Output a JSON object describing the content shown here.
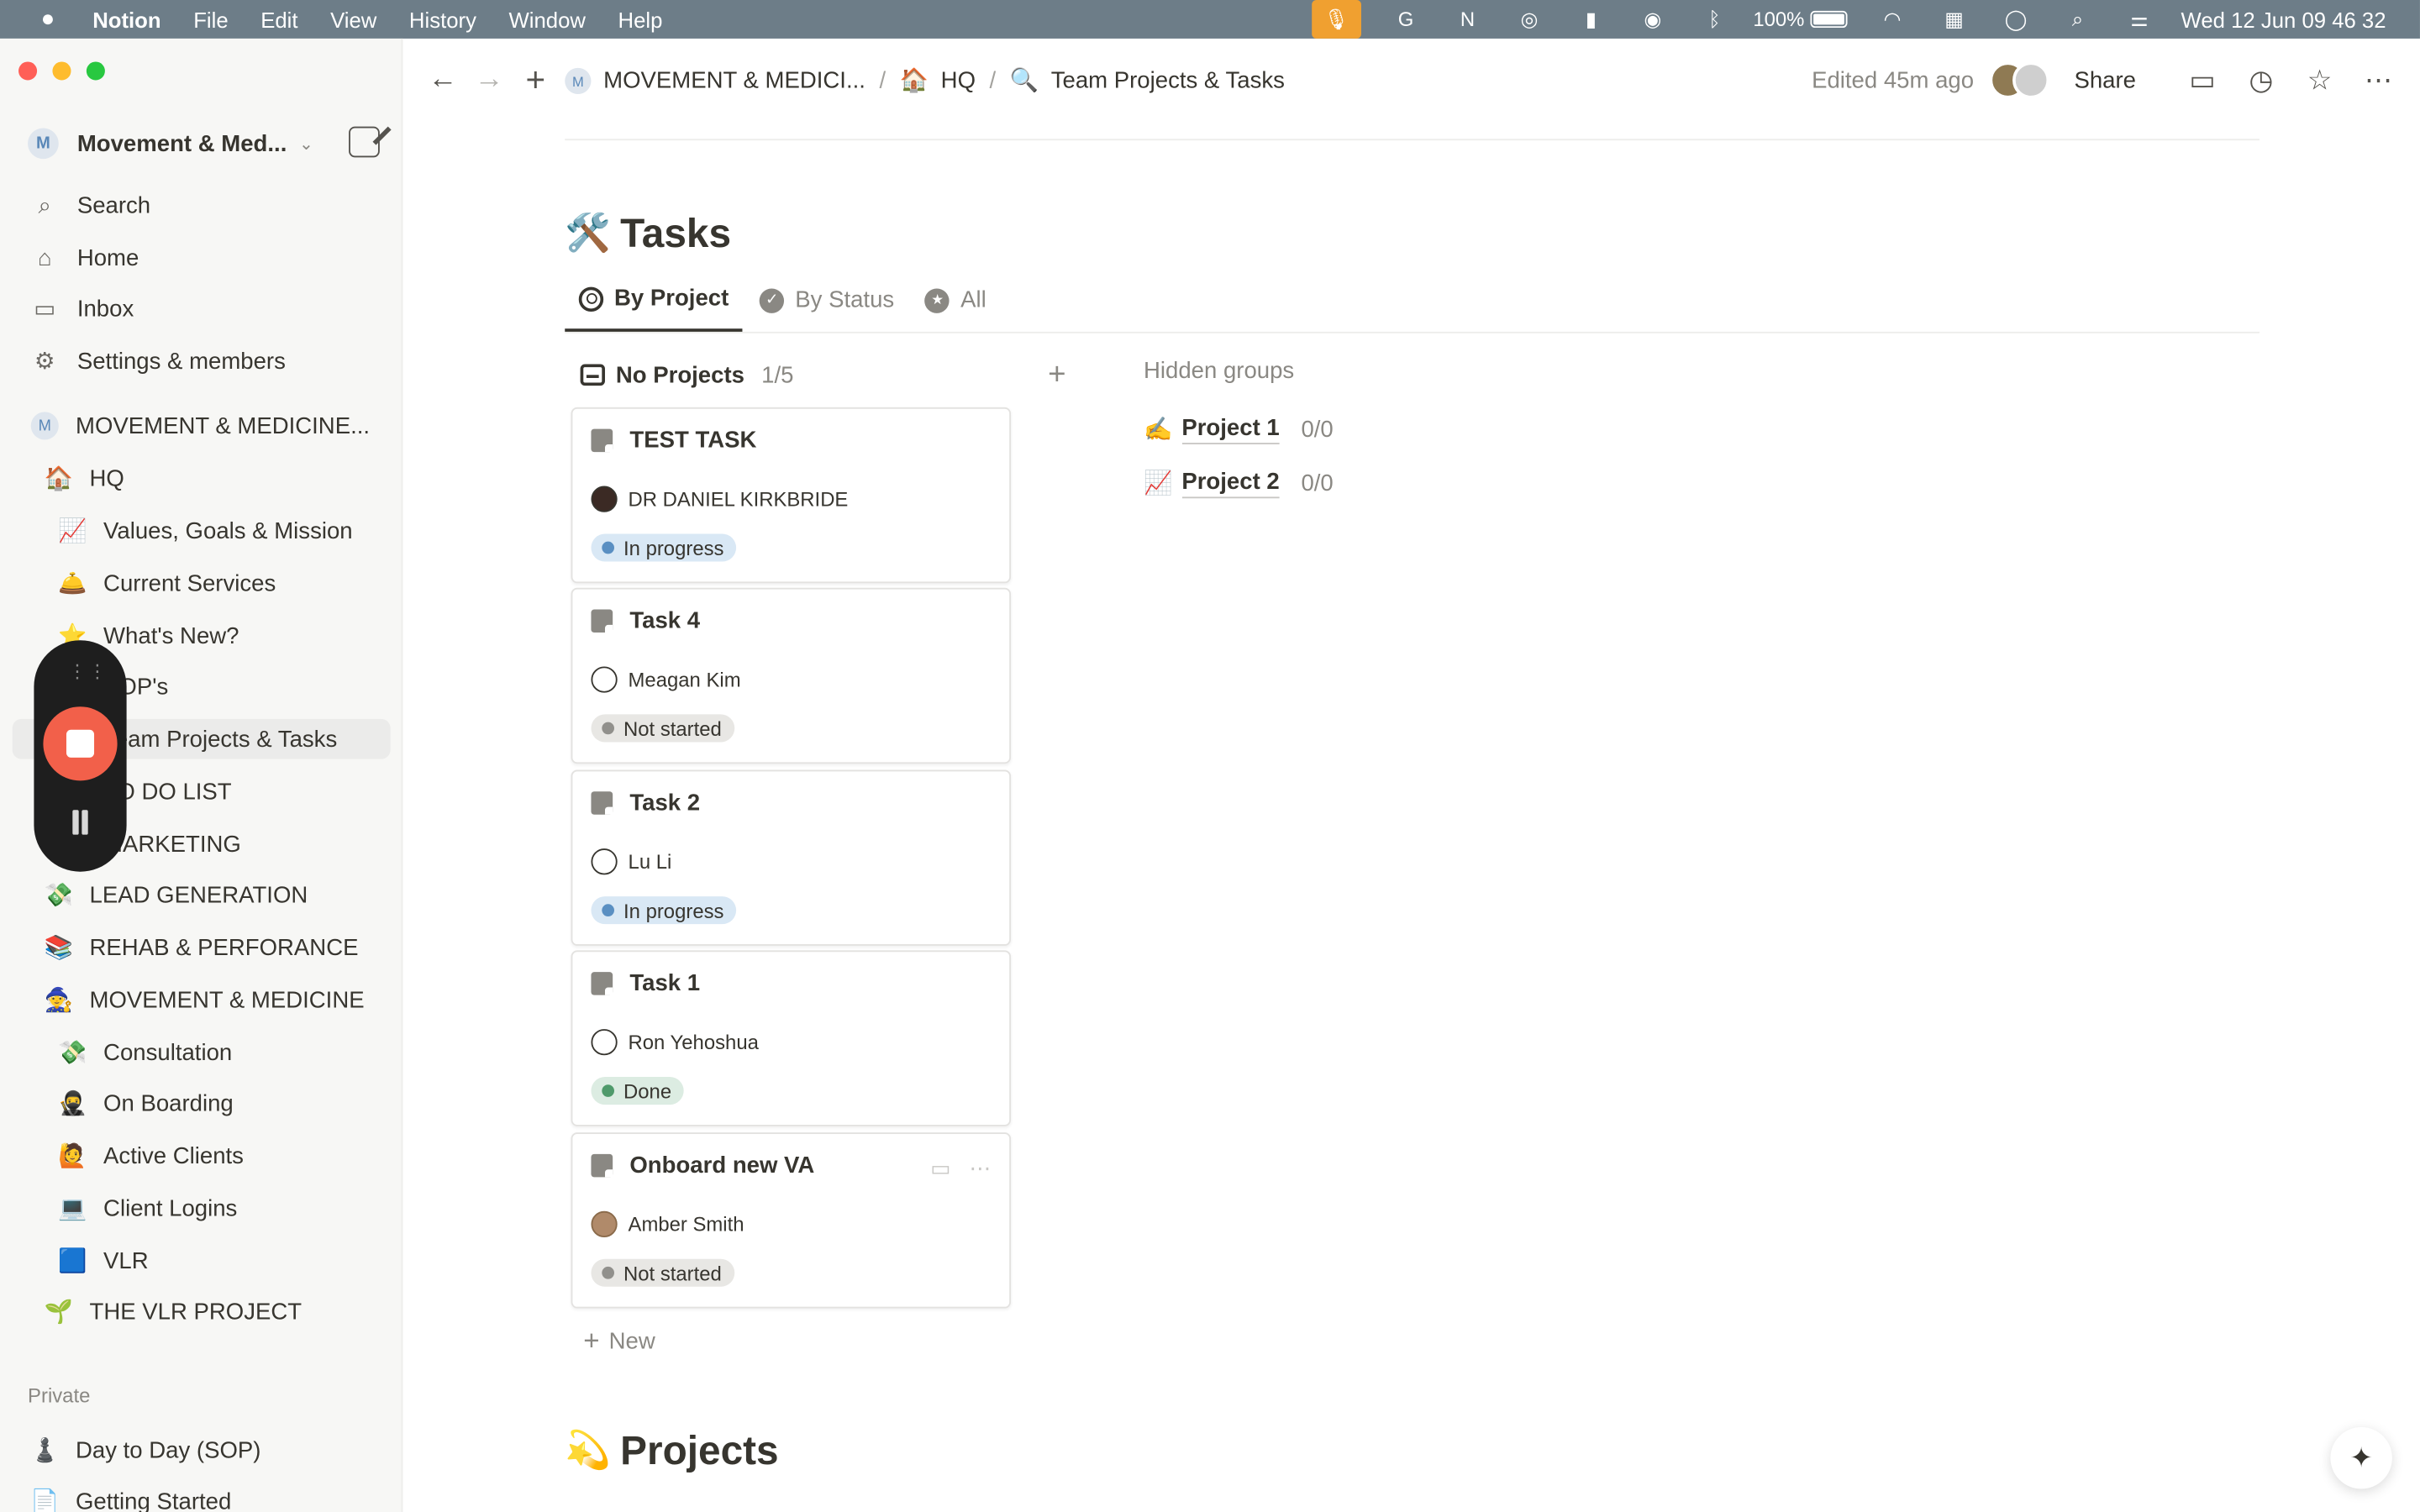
{
  "menubar": {
    "app": "Notion",
    "items": [
      "File",
      "Edit",
      "View",
      "History",
      "Window",
      "Help"
    ],
    "battery": "100%",
    "datetime": "Wed 12 Jun  09 46 32"
  },
  "sidebar": {
    "workspace": "Movement & Med...",
    "nav": [
      {
        "label": "Search",
        "icon": "search-icon"
      },
      {
        "label": "Home",
        "icon": "home-icon"
      },
      {
        "label": "Inbox",
        "icon": "inbox-icon"
      },
      {
        "label": "Settings & members",
        "icon": "gear-icon"
      }
    ],
    "teamspace": "MOVEMENT & MEDICINE...",
    "tree": [
      {
        "label": "HQ",
        "emoji": "🏠",
        "indent": 1
      },
      {
        "label": "Values, Goals & Mission",
        "emoji": "📈",
        "indent": 2
      },
      {
        "label": "Current Services",
        "emoji": "🛎️",
        "indent": 2
      },
      {
        "label": "What's New?",
        "emoji": "⭐",
        "indent": 2
      },
      {
        "label": "SOP's",
        "emoji": "📄",
        "indent": 2
      },
      {
        "label": "Team Projects & Tasks",
        "emoji": "🔍",
        "indent": 2,
        "active": true
      },
      {
        "label": "TO DO LIST",
        "emoji": "✅",
        "indent": 2
      },
      {
        "label": "MARKETING",
        "emoji": "📣",
        "indent": 2
      },
      {
        "label": "LEAD GENERATION",
        "emoji": "💸",
        "indent": 1
      },
      {
        "label": "REHAB & PERFORANCE",
        "emoji": "📚",
        "indent": 1
      },
      {
        "label": "MOVEMENT & MEDICINE",
        "emoji": "🧙",
        "indent": 1
      },
      {
        "label": "Consultation",
        "emoji": "💸",
        "indent": 2
      },
      {
        "label": "On Boarding",
        "emoji": "🥷",
        "indent": 2
      },
      {
        "label": "Active Clients",
        "emoji": "🙋",
        "indent": 2
      },
      {
        "label": "Client Logins",
        "emoji": "💻",
        "indent": 2
      },
      {
        "label": "VLR",
        "emoji": "🟦",
        "indent": 2
      },
      {
        "label": "THE VLR PROJECT",
        "emoji": "🌱",
        "indent": 1
      }
    ],
    "private_label": "Private",
    "private": [
      {
        "label": "Day to Day (SOP)",
        "emoji": "♟️"
      },
      {
        "label": "Getting Started",
        "emoji": "📄"
      }
    ]
  },
  "topbar": {
    "breadcrumbs": [
      {
        "label": "MOVEMENT & MEDICI...",
        "emoji": "Ⓜ️"
      },
      {
        "label": "HQ",
        "emoji": "🏠"
      },
      {
        "label": "Team Projects & Tasks",
        "emoji": "🔍"
      }
    ],
    "edited": "Edited 45m ago",
    "share": "Share"
  },
  "tasks": {
    "title": "Tasks",
    "emoji": "🛠️",
    "tabs": [
      {
        "label": "By Project",
        "active": true,
        "icon": "target-icon"
      },
      {
        "label": "By Status",
        "active": false,
        "icon": "check-circle-icon"
      },
      {
        "label": "All",
        "active": false,
        "icon": "star-circle-icon"
      }
    ],
    "group": {
      "label": "No Projects",
      "count": "1/5"
    },
    "cards": [
      {
        "title": "TEST TASK",
        "person": "DR DANIEL KIRKBRIDE",
        "avatar": "dark",
        "status": "In progress",
        "status_kind": "progress"
      },
      {
        "title": "Task 4",
        "person": "Meagan Kim",
        "avatar": "line",
        "status": "Not started",
        "status_kind": "not"
      },
      {
        "title": "Task 2",
        "person": "Lu Li",
        "avatar": "line",
        "status": "In progress",
        "status_kind": "progress"
      },
      {
        "title": "Task 1",
        "person": "Ron Yehoshua",
        "avatar": "line",
        "status": "Done",
        "status_kind": "done"
      },
      {
        "title": "Onboard new VA",
        "person": "Amber Smith",
        "avatar": "photo",
        "status": "Not started",
        "status_kind": "not"
      }
    ],
    "new_label": "New",
    "hidden_label": "Hidden groups",
    "hidden": [
      {
        "label": "Project 1",
        "emoji": "✍️",
        "count": "0/0"
      },
      {
        "label": "Project 2",
        "emoji": "📈",
        "count": "0/0"
      }
    ]
  },
  "projects": {
    "title": "Projects",
    "emoji": "💫"
  }
}
